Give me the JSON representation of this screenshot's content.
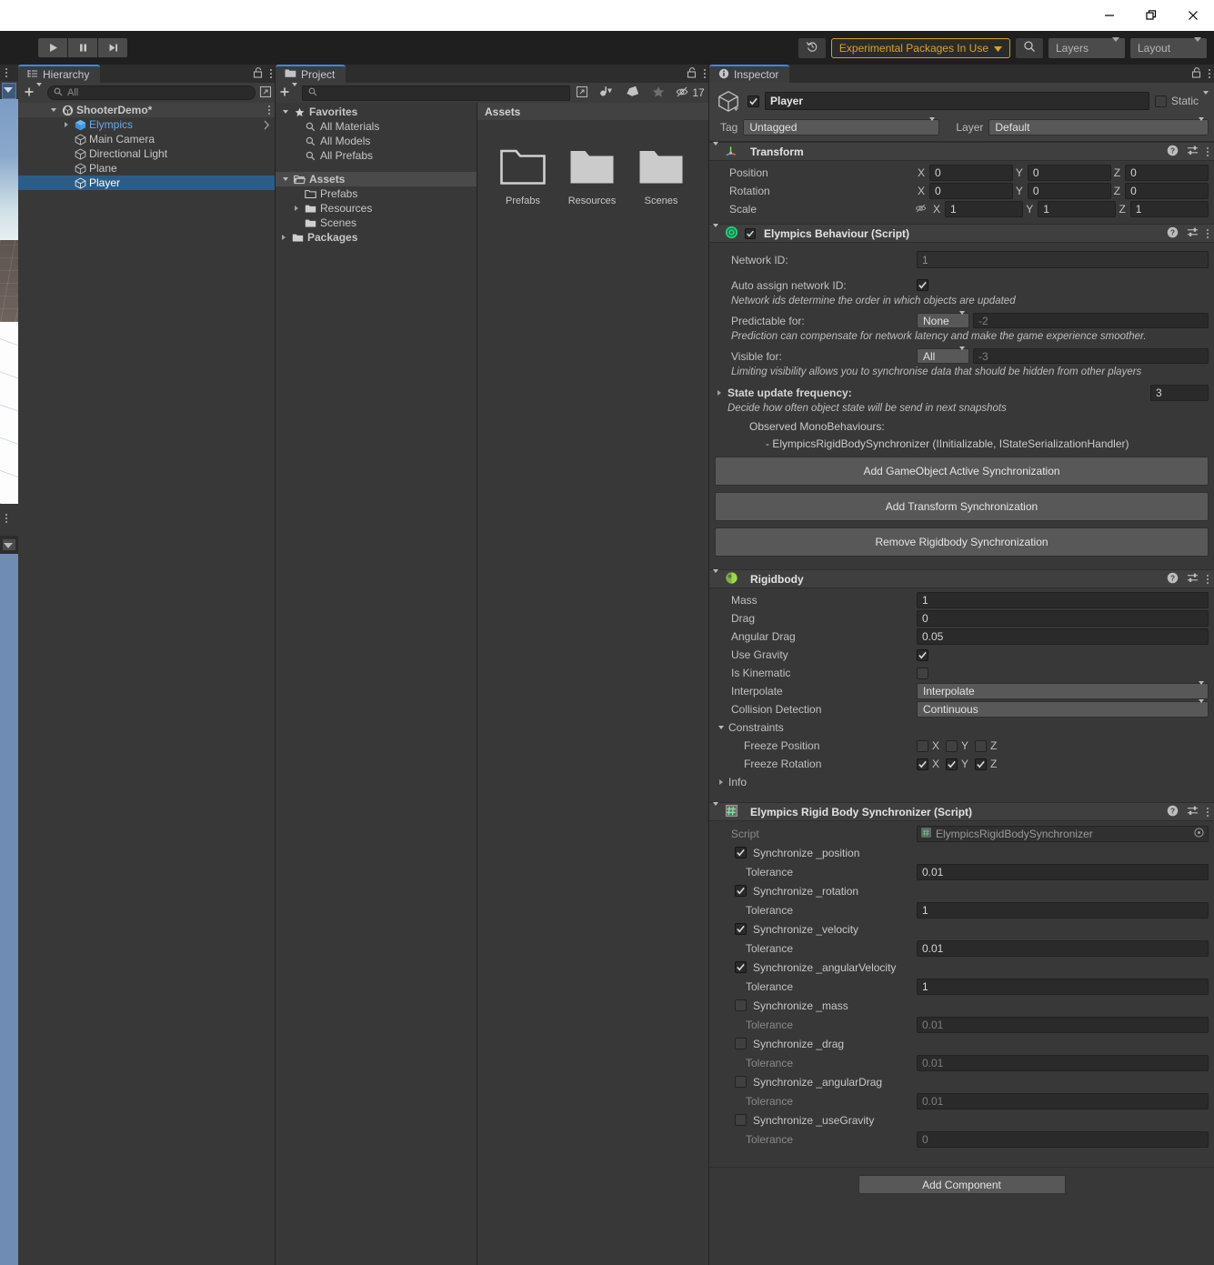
{
  "window": {
    "buttons": [
      {
        "name": "minimize",
        "glyph": "minimize-icon"
      },
      {
        "name": "maximize",
        "glyph": "maximize-icon"
      },
      {
        "name": "close",
        "glyph": "close-icon"
      }
    ]
  },
  "toolbar": {
    "play_label": "play-icon",
    "pause_label": "pause-icon",
    "step_label": "step-icon",
    "history_icon": "history-icon",
    "experimental_packages": "Experimental Packages In Use",
    "search_icon": "search-icon",
    "layers": "Layers",
    "layout": "Layout"
  },
  "hierarchy": {
    "tab": "Hierarchy",
    "lock_icon": "lock-icon",
    "menu_icon": "kebab-icon",
    "add_icon": "plus-icon",
    "search_placeholder": "All",
    "search_value": "",
    "rows": [
      {
        "label": "ShooterDemo*",
        "indent": 1,
        "icon": "scene-icon",
        "twisty": "down",
        "state": "root",
        "kebab": true
      },
      {
        "label": "Elympics",
        "indent": 2,
        "icon": "prefab-cube-icon",
        "twisty": "right",
        "state": "prefab",
        "chevron": true
      },
      {
        "label": "Main Camera",
        "indent": 2,
        "icon": "gameobject-cube-icon",
        "twisty": "none",
        "state": "normal"
      },
      {
        "label": "Directional Light",
        "indent": 2,
        "icon": "gameobject-cube-icon",
        "twisty": "none",
        "state": "normal"
      },
      {
        "label": "Plane",
        "indent": 2,
        "icon": "gameobject-cube-icon",
        "twisty": "none",
        "state": "normal"
      },
      {
        "label": "Player",
        "indent": 2,
        "icon": "gameobject-cube-icon",
        "twisty": "none",
        "state": "selected"
      }
    ]
  },
  "project": {
    "tab": "Project",
    "search_value": "",
    "hidden_count": "17",
    "toolbar_icons": [
      "plus-icon",
      "search-icon",
      "expand-icon",
      "type-filter-icon",
      "label-filter-icon",
      "favorite-star-icon",
      "hidden-packages-icon"
    ],
    "tree": [
      {
        "label": "Favorites",
        "indent": 0,
        "icon": "star-icon",
        "twisty": "down",
        "bold": true
      },
      {
        "label": "All Materials",
        "indent": 1,
        "icon": "search-icon",
        "twisty": "none"
      },
      {
        "label": "All Models",
        "indent": 1,
        "icon": "search-icon",
        "twisty": "none"
      },
      {
        "label": "All Prefabs",
        "indent": 1,
        "icon": "search-icon",
        "twisty": "none"
      },
      {
        "label": "Assets",
        "indent": 0,
        "icon": "folder-open-icon",
        "twisty": "down",
        "bold": true,
        "selected": true
      },
      {
        "label": "Prefabs",
        "indent": 1,
        "icon": "folder-empty-icon",
        "twisty": "none"
      },
      {
        "label": "Resources",
        "indent": 1,
        "icon": "folder-icon",
        "twisty": "right"
      },
      {
        "label": "Scenes",
        "indent": 1,
        "icon": "folder-icon",
        "twisty": "none"
      },
      {
        "label": "Packages",
        "indent": 0,
        "icon": "folder-icon",
        "twisty": "right",
        "bold": true
      }
    ],
    "breadcrumb": "Assets",
    "items": [
      {
        "label": "Prefabs",
        "icon": "folder-empty-icon"
      },
      {
        "label": "Resources",
        "icon": "folder-filled-icon"
      },
      {
        "label": "Scenes",
        "icon": "folder-filled-icon"
      }
    ]
  },
  "inspector": {
    "tab": "Inspector",
    "lock_icon": "lock-icon",
    "menu_icon": "kebab-icon",
    "object": {
      "enabled": true,
      "name": "Player",
      "static_label": "Static",
      "static_checked": false,
      "tag_label": "Tag",
      "tag_value": "Untagged",
      "layer_label": "Layer",
      "layer_value": "Default"
    },
    "transform": {
      "title": "Transform",
      "rows": [
        {
          "label": "Position",
          "x": "0",
          "y": "0",
          "z": "0"
        },
        {
          "label": "Rotation",
          "x": "0",
          "y": "0",
          "z": "0"
        },
        {
          "label": "Scale",
          "x": "1",
          "y": "1",
          "z": "1",
          "link_icon": "constrain-off-icon"
        }
      ],
      "axes": [
        "X",
        "Y",
        "Z"
      ]
    },
    "elympics_behaviour": {
      "title": "Elympics Behaviour (Script)",
      "enabled": true,
      "network_id_label": "Network ID:",
      "network_id_value": "1",
      "auto_assign_label": "Auto assign network ID:",
      "auto_assign_checked": true,
      "auto_assign_help": "Network ids determine the order in which objects are updated",
      "predictable_label": "Predictable for:",
      "predictable_value": "None",
      "predictable_num": "-2",
      "predictable_help": "Prediction can compensate for network latency and make the game experience smoother.",
      "visible_label": "Visible for:",
      "visible_value": "All",
      "visible_num": "-3",
      "visible_help": "Limiting visibility allows you to synchronise data that should be hidden from other players",
      "state_freq_label": "State update frequency:",
      "state_freq_value": "3",
      "state_freq_help": "Decide how often object state will be send in next snapshots",
      "observed_title": "Observed MonoBehaviours:",
      "observed_items": [
        "- ElympicsRigidBodySynchronizer (IInitializable, IStateSerializationHandler)"
      ],
      "buttons": [
        "Add GameObject Active Synchronization",
        "Add Transform Synchronization",
        "Remove Rigidbody Synchronization"
      ]
    },
    "rigidbody": {
      "title": "Rigidbody",
      "mass_label": "Mass",
      "mass_value": "1",
      "drag_label": "Drag",
      "drag_value": "0",
      "angular_drag_label": "Angular Drag",
      "angular_drag_value": "0.05",
      "use_gravity_label": "Use Gravity",
      "use_gravity_checked": true,
      "is_kinematic_label": "Is Kinematic",
      "is_kinematic_checked": false,
      "interpolate_label": "Interpolate",
      "interpolate_value": "Interpolate",
      "collision_label": "Collision Detection",
      "collision_value": "Continuous",
      "constraints_label": "Constraints",
      "freeze_position_label": "Freeze Position",
      "freeze_position": [
        false,
        false,
        false
      ],
      "freeze_rotation_label": "Freeze Rotation",
      "freeze_rotation": [
        true,
        true,
        true
      ],
      "axes": [
        "X",
        "Y",
        "Z"
      ],
      "info_label": "Info"
    },
    "rb_sync": {
      "title": "Elympics Rigid Body Synchronizer (Script)",
      "script_label": "Script",
      "script_value": "ElympicsRigidBodySynchronizer",
      "tolerance_label": "Tolerance",
      "fields": [
        {
          "label": "Synchronize _position",
          "checked": true,
          "tolerance": "0.01"
        },
        {
          "label": "Synchronize _rotation",
          "checked": true,
          "tolerance": "1"
        },
        {
          "label": "Synchronize _velocity",
          "checked": true,
          "tolerance": "0.01"
        },
        {
          "label": "Synchronize _angularVelocity",
          "checked": true,
          "tolerance": "1"
        },
        {
          "label": "Synchronize _mass",
          "checked": false,
          "tolerance": "0.01"
        },
        {
          "label": "Synchronize _drag",
          "checked": false,
          "tolerance": "0.01"
        },
        {
          "label": "Synchronize _angularDrag",
          "checked": false,
          "tolerance": "0.01"
        },
        {
          "label": "Synchronize _useGravity",
          "checked": false,
          "tolerance": "0"
        }
      ]
    },
    "add_component": "Add Component"
  },
  "colors": {
    "panel_bg": "#383838",
    "header_bg": "#3f3f3f",
    "tab_active": "#3c3c3c",
    "selection_blue": "#2c5d87",
    "accent_blue": "#4186e0",
    "prefab_blue": "#6aa9e8",
    "warning_yellow": "#d9a520",
    "field_bg": "#2a2a2a",
    "button_bg": "#585858"
  }
}
